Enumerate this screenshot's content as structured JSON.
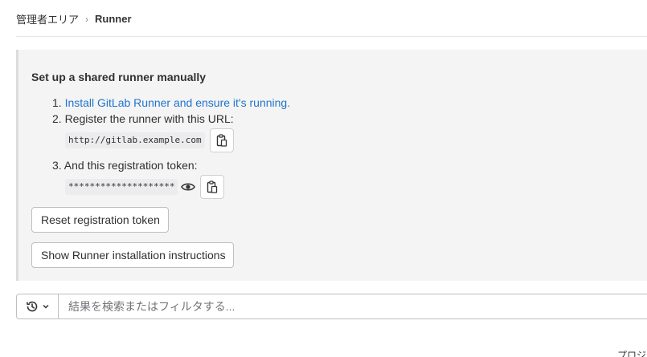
{
  "breadcrumb": {
    "admin_area": "管理者エリア",
    "current": "Runner"
  },
  "panel": {
    "title": "Set up a shared runner manually",
    "step1_prefix": "1. ",
    "step1_link": "Install GitLab Runner and ensure it's running.",
    "step2": "2. Register the runner with this URL:",
    "url": "http://gitlab.example.com",
    "step3": "3. And this registration token:",
    "token": "********************",
    "reset_button": "Reset registration token",
    "show_instructions_button": "Show Runner installation instructions"
  },
  "filter": {
    "placeholder": "結果を検索またはフィルタする..."
  },
  "bottom_clipped_text": "プロジ",
  "colors": {
    "link": "#1f75cb",
    "panel_bg": "#f4f4f4",
    "text": "#303030"
  },
  "icons": {
    "copy": "clipboard-icon",
    "eye": "eye-icon",
    "history": "history-icon",
    "chevron": "chevron-down-icon"
  }
}
